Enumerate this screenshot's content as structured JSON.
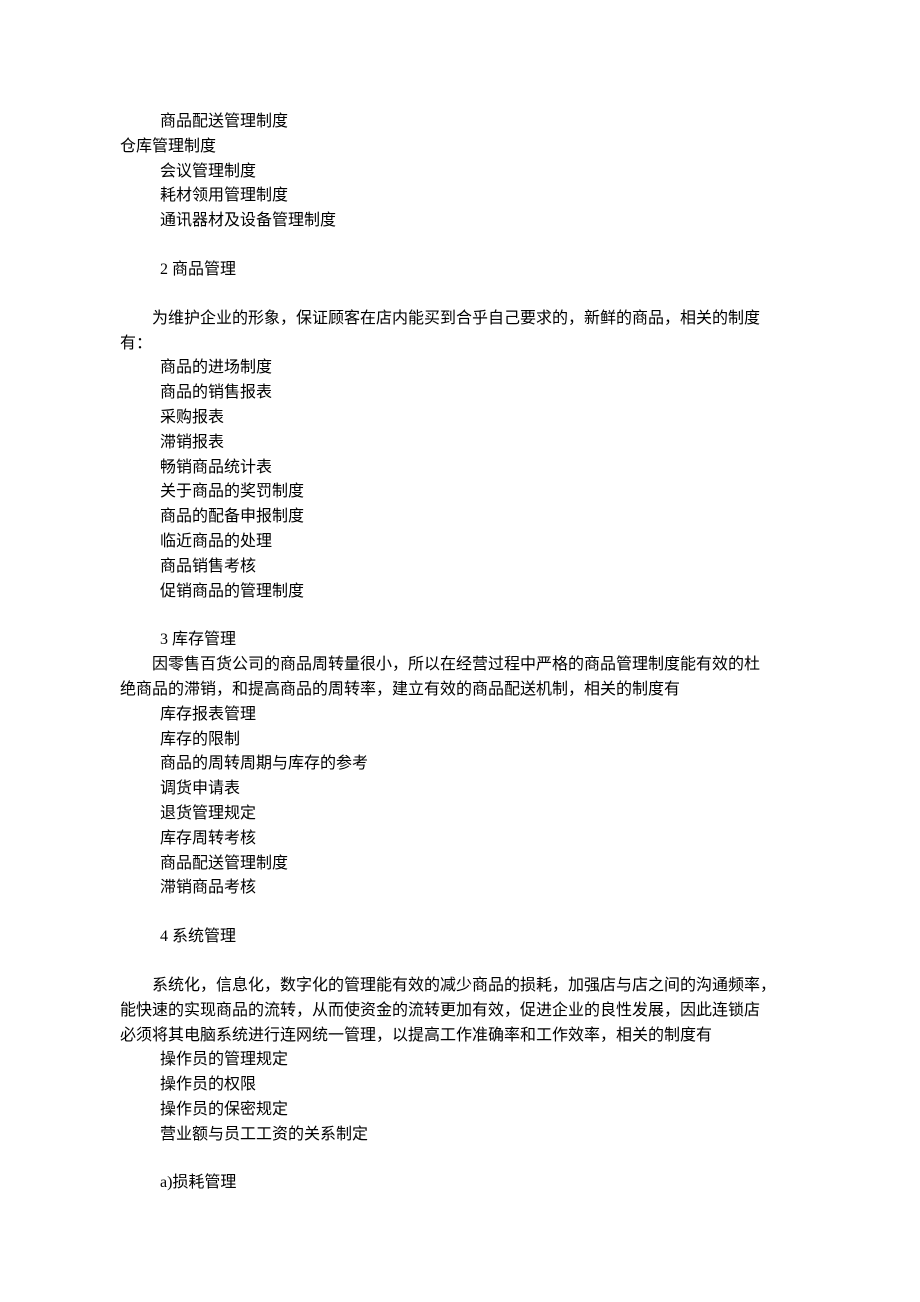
{
  "block1": {
    "items": [
      "商品配送管理制度"
    ]
  },
  "block2": {
    "heading": "仓库管理制度",
    "items": [
      "会议管理制度",
      "耗材领用管理制度",
      "通讯器材及设备管理制度"
    ]
  },
  "section2": {
    "heading": "2  商品管理",
    "intro_line1": "为维护企业的形象，保证顾客在店内能买到合乎自己要求的，新鲜的商品，相关的制度",
    "intro_line2": "有：",
    "items": [
      "商品的进场制度",
      "商品的销售报表",
      "采购报表",
      "滞销报表",
      "畅销商品统计表",
      "关于商品的奖罚制度",
      "商品的配备申报制度",
      "临近商品的处理",
      "商品销售考核",
      "促销商品的管理制度"
    ]
  },
  "section3": {
    "heading": "3  库存管理",
    "intro_line1": "因零售百货公司的商品周转量很小，所以在经营过程中严格的商品管理制度能有效的杜",
    "intro_line2": "绝商品的滞销，和提高商品的周转率，建立有效的商品配送机制，相关的制度有",
    "items": [
      "库存报表管理",
      "库存的限制",
      "商品的周转周期与库存的参考",
      "调货申请表",
      "退货管理规定",
      "库存周转考核",
      "商品配送管理制度",
      "滞销商品考核"
    ]
  },
  "section4": {
    "heading": "4  系统管理",
    "intro_line1": "系统化，信息化，数字化的管理能有效的减少商品的损耗，加强店与店之间的沟通频率，",
    "intro_line2": "能快速的实现商品的流转，从而使资金的流转更加有效，促进企业的良性发展，因此连锁店",
    "intro_line3": "必须将其电脑系统进行连网统一管理，以提高工作准确率和工作效率，相关的制度有",
    "items": [
      "操作员的管理规定",
      "操作员的权限",
      "操作员的保密规定",
      "营业额与员工工资的关系制定"
    ]
  },
  "sectionA": {
    "heading": "a)损耗管理"
  }
}
